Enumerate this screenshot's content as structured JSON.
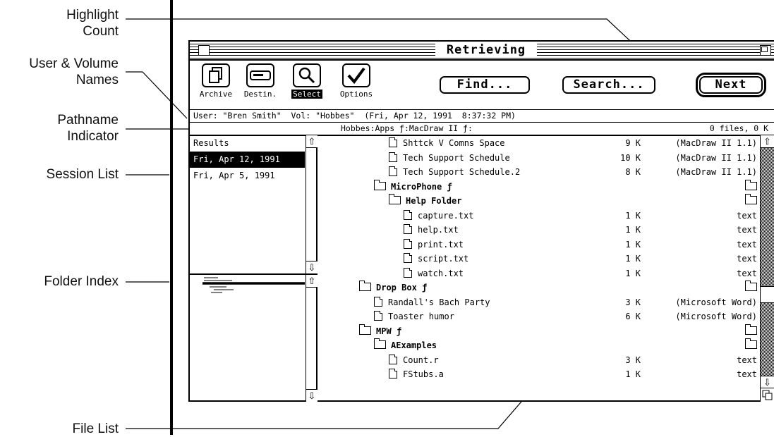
{
  "annotations": {
    "highlight_count": "Highlight\nCount",
    "user_volume_names": "User & Volume\nNames",
    "pathname_indicator": "Pathname\nIndicator",
    "session_list": "Session List",
    "folder_index": "Folder Index",
    "file_list": "File List"
  },
  "window": {
    "title": "Retrieving"
  },
  "toolbar": {
    "tools": [
      {
        "label": "Archive",
        "icon": "archive-icon"
      },
      {
        "label": "Destin.",
        "icon": "destination-icon"
      },
      {
        "label": "Select",
        "icon": "magnifier-icon",
        "selected": true
      },
      {
        "label": "Options",
        "icon": "checkmark-icon"
      }
    ],
    "find_label": "Find...",
    "search_label": "Search...",
    "next_label": "Next"
  },
  "info": {
    "user_volume": "User: \"Bren Smith\"  Vol: \"Hobbes\"  (Fri, Apr 12, 1991  8:37:32 PM)",
    "path": "Hobbes:Apps ƒ:MacDraw II ƒ:",
    "count": "0 files, 0 K"
  },
  "sessions": {
    "header": "Results",
    "items": [
      {
        "label": "Fri, Apr 12, 1991",
        "selected": true
      },
      {
        "label": "Fri, Apr 5, 1991",
        "selected": false
      }
    ]
  },
  "files": [
    {
      "type": "file",
      "name": "Shttck V Comns Space",
      "size": "9 K",
      "kind": "(MacDraw II 1.1)",
      "indent": 1
    },
    {
      "type": "file",
      "name": "Tech Support Schedule",
      "size": "10 K",
      "kind": "(MacDraw II 1.1)",
      "indent": 1
    },
    {
      "type": "file",
      "name": "Tech Support Schedule.2",
      "size": "8 K",
      "kind": "(MacDraw II 1.1)",
      "indent": 1
    },
    {
      "type": "folder",
      "name": "MicroPhone ƒ",
      "size": "",
      "kind": "",
      "indent": 0
    },
    {
      "type": "folder",
      "name": "Help Folder",
      "size": "",
      "kind": "",
      "indent": 1
    },
    {
      "type": "file",
      "name": "capture.txt",
      "size": "1 K",
      "kind": "text",
      "indent": 2
    },
    {
      "type": "file",
      "name": "help.txt",
      "size": "1 K",
      "kind": "text",
      "indent": 2
    },
    {
      "type": "file",
      "name": "print.txt",
      "size": "1 K",
      "kind": "text",
      "indent": 2
    },
    {
      "type": "file",
      "name": "script.txt",
      "size": "1 K",
      "kind": "text",
      "indent": 2
    },
    {
      "type": "file",
      "name": "watch.txt",
      "size": "1 K",
      "kind": "text",
      "indent": 2
    },
    {
      "type": "folder",
      "name": "Drop Box ƒ",
      "size": "",
      "kind": "",
      "indent": -1
    },
    {
      "type": "file",
      "name": "Randall's Bach Party",
      "size": "3 K",
      "kind": "(Microsoft Word)",
      "indent": 0
    },
    {
      "type": "file",
      "name": "Toaster humor",
      "size": "6 K",
      "kind": "(Microsoft Word)",
      "indent": 0
    },
    {
      "type": "folder",
      "name": "MPW ƒ",
      "size": "",
      "kind": "",
      "indent": -1
    },
    {
      "type": "folder",
      "name": "AExamples",
      "size": "",
      "kind": "",
      "indent": 0
    },
    {
      "type": "file",
      "name": "Count.r",
      "size": "3 K",
      "kind": "text",
      "indent": 1
    },
    {
      "type": "file",
      "name": "FStubs.a",
      "size": "1 K",
      "kind": "text",
      "indent": 1
    }
  ]
}
